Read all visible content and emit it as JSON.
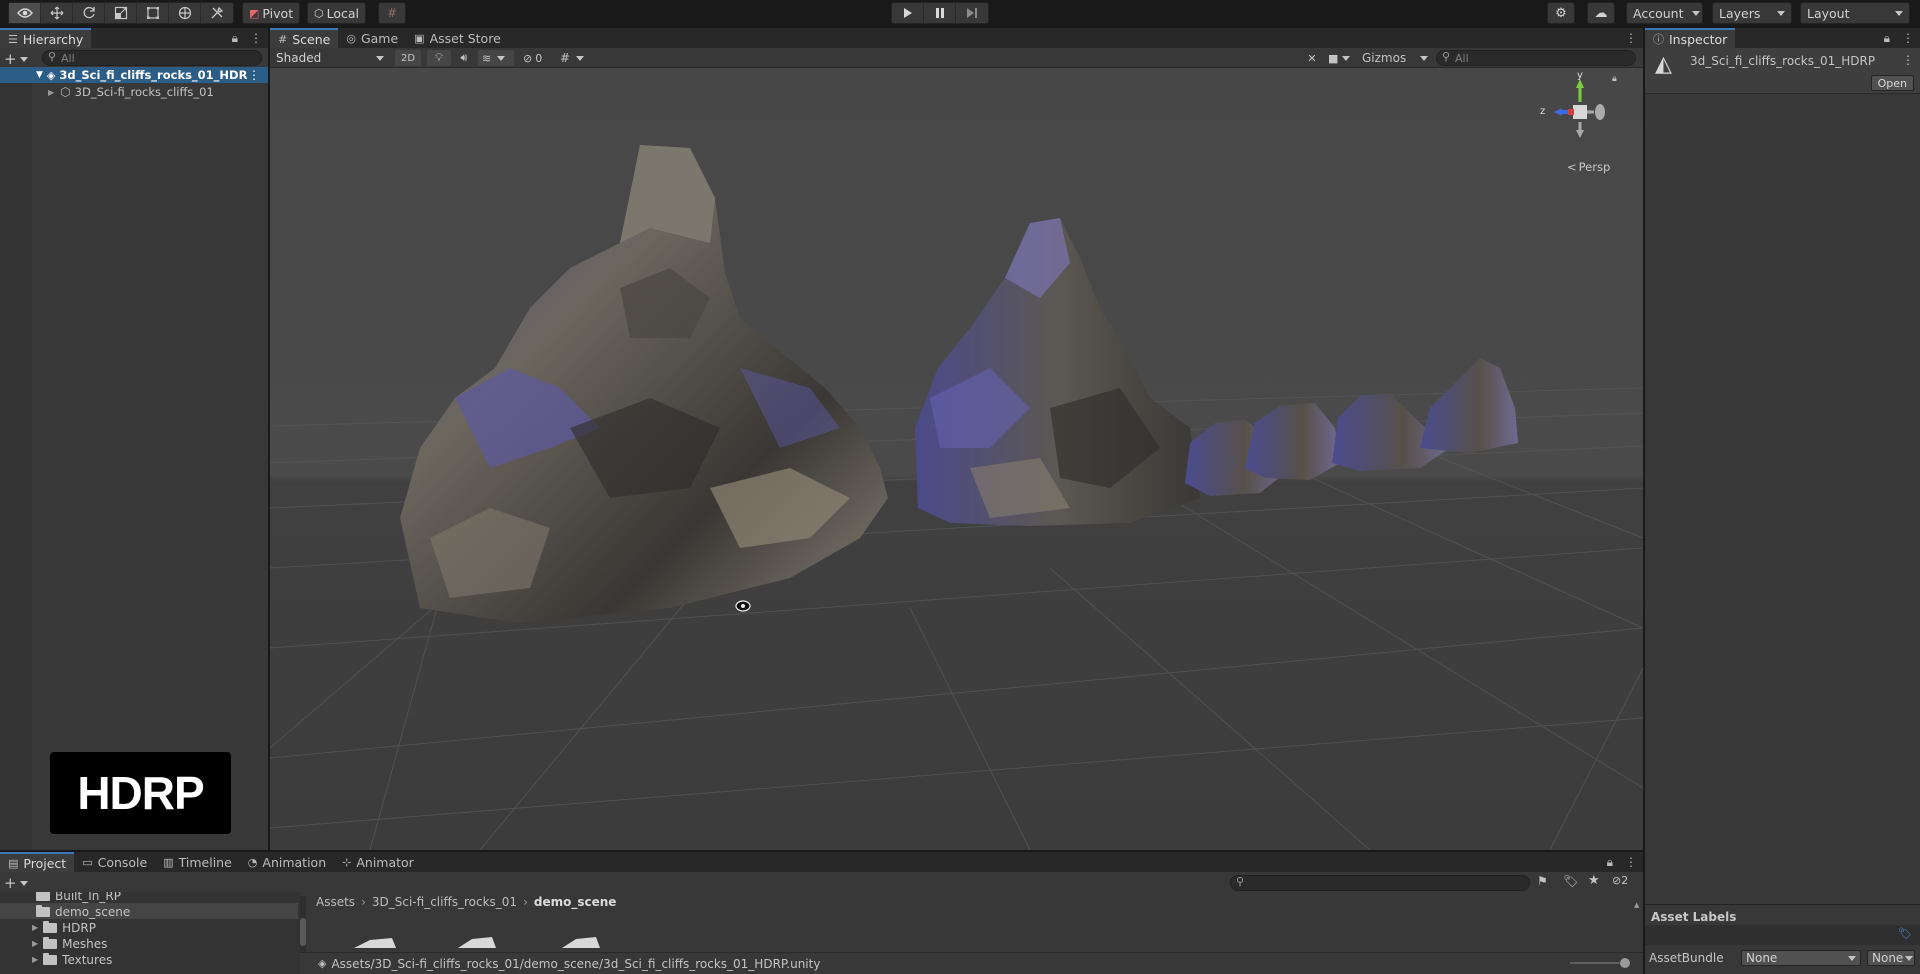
{
  "toolbar": {
    "pivot_label": "Pivot",
    "local_label": "Local",
    "account_label": "Account",
    "layers_label": "Layers",
    "layout_label": "Layout"
  },
  "hierarchy": {
    "tab_label": "Hierarchy",
    "search_placeholder": "All",
    "scene_name": "3d_Sci_fi_cliffs_rocks_01_HDR",
    "child_object": "3D_Sci-fi_rocks_cliffs_01"
  },
  "scene": {
    "tabs": [
      {
        "label": "Scene"
      },
      {
        "label": "Game"
      },
      {
        "label": "Asset Store"
      }
    ],
    "shading_mode": "Shaded",
    "twod_label": "2D",
    "hidden_count": "0",
    "gizmos_label": "Gizmos",
    "search_placeholder": "All",
    "persp_label": "Persp",
    "axis_y": "y",
    "axis_z": "z"
  },
  "badge": {
    "text": "HDRP"
  },
  "inspector": {
    "tab_label": "Inspector",
    "asset_name": "3d_Sci_fi_cliffs_rocks_01_HDRP",
    "open_button": "Open",
    "asset_labels_header": "Asset Labels",
    "asset_bundle_label": "AssetBundle",
    "asset_bundle_value": "None",
    "asset_bundle_variant": "None"
  },
  "project": {
    "tabs": [
      {
        "label": "Project"
      },
      {
        "label": "Console"
      },
      {
        "label": "Timeline"
      },
      {
        "label": "Animation"
      },
      {
        "label": "Animator"
      }
    ],
    "folders": [
      "Built_In_RP",
      "demo_scene",
      "HDRP",
      "Meshes",
      "Textures"
    ],
    "breadcrumb": [
      "Assets",
      "3D_Sci-fi_cliffs_rocks_01",
      "demo_scene"
    ],
    "visible_count": "2",
    "status_path": "Assets/3D_Sci-fi_cliffs_rocks_01/demo_scene/3d_Sci_fi_cliffs_rocks_01_HDRP.unity"
  },
  "colors": {
    "selection": "#2c5d87",
    "accent_tab": "#3a79bb",
    "panel_bg": "#383838",
    "scene_bg": "#474747"
  }
}
